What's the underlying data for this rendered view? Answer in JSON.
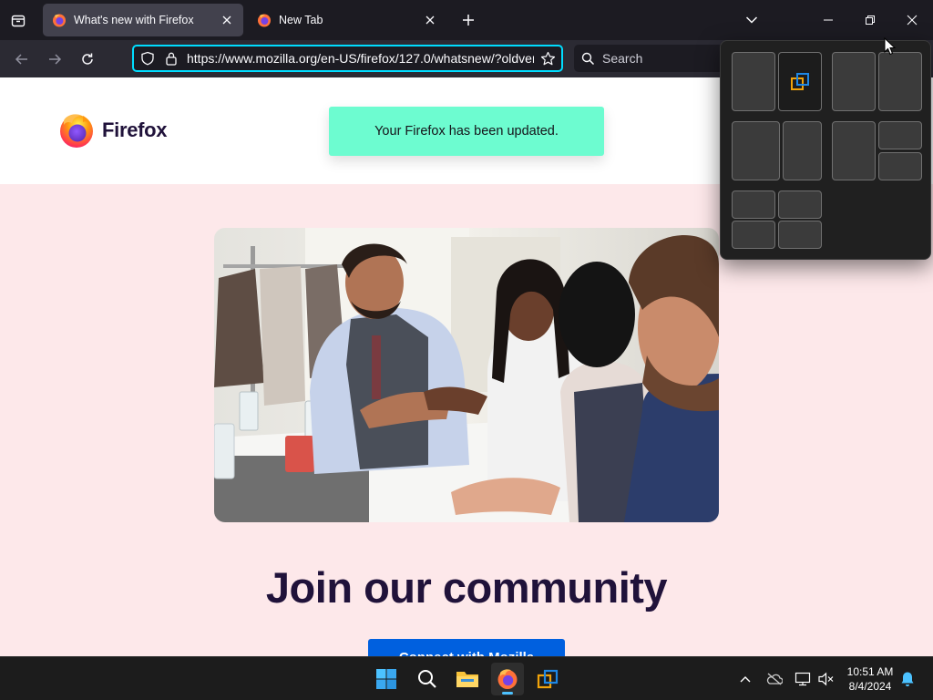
{
  "tabs": [
    {
      "title": "What's new with Firefox",
      "active": true
    },
    {
      "title": "New Tab",
      "active": false
    }
  ],
  "navbar": {
    "url": "https://www.mozilla.org/en-US/firefox/127.0/whatsnew/?oldver",
    "search_placeholder": "Search"
  },
  "page": {
    "brand": "Firefox",
    "notice": "Your Firefox has been updated.",
    "heading": "Join our community",
    "cta": "Connect with Mozilla"
  },
  "taskbar": {
    "clock_time": "10:51 AM",
    "clock_date": "8/4/2024"
  },
  "colors": {
    "accent_focus": "#00ddff",
    "notice_bg": "#6dfcd0",
    "page_bg": "#fde8ea",
    "cta_bg": "#0060df",
    "heading": "#20123a"
  },
  "icons": [
    "tab-list-icon",
    "firefox-icon",
    "close-icon",
    "plus-icon",
    "chevron-down-icon",
    "minimize-icon",
    "restore-icon",
    "back-arrow-icon",
    "forward-arrow-icon",
    "reload-icon",
    "shield-icon",
    "lock-icon",
    "star-icon",
    "search-icon",
    "windows-start-icon",
    "file-explorer-icon",
    "virtualbox-icon",
    "chevron-up-icon",
    "onedrive-icon",
    "network-icon",
    "volume-muted-icon",
    "bell-icon"
  ]
}
